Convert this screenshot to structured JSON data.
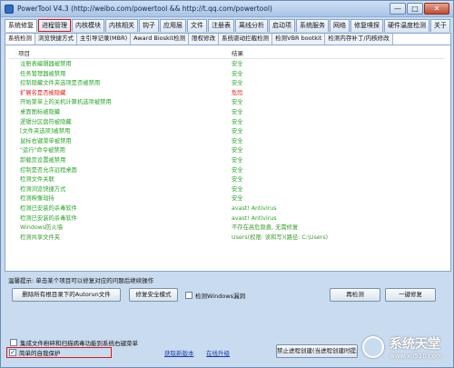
{
  "window": {
    "title": "PowerTool V4.3 (http://weibo.com/powertool && http://t.qq.com/powertool)",
    "minimize": "—",
    "maximize": "□",
    "close": "✕"
  },
  "main_tabs": [
    {
      "label": "系统修复",
      "active": true
    },
    {
      "label": "进程管理",
      "highlighted": true
    },
    {
      "label": "内核模块"
    },
    {
      "label": "内核相关"
    },
    {
      "label": "钩子"
    },
    {
      "label": "应用层"
    },
    {
      "label": "文件"
    },
    {
      "label": "注册表"
    },
    {
      "label": "离线分析"
    },
    {
      "label": "启动项"
    },
    {
      "label": "系统服务"
    },
    {
      "label": "网络"
    },
    {
      "label": "修复嗅探"
    },
    {
      "label": "硬件温度检测"
    },
    {
      "label": "关于"
    }
  ],
  "sub_tabs": [
    {
      "label": "系统检测",
      "active": true
    },
    {
      "label": "浏览快捷方式"
    },
    {
      "label": "主引导记录(MBR)"
    },
    {
      "label": "Award Bioskit检测"
    },
    {
      "label": "限权修改"
    },
    {
      "label": "系统驱动拦截检测"
    },
    {
      "label": "检测VBR bootkit"
    },
    {
      "label": "检测内存补丁/内核修改"
    }
  ],
  "list": {
    "header_item": "项目",
    "header_result": "结果",
    "rows": [
      {
        "item": "注册表编辑器被禁用",
        "result": "安全",
        "status": "safe"
      },
      {
        "item": "任务管理器被禁用",
        "result": "安全",
        "status": "safe"
      },
      {
        "item": "控制隐藏文件夹选项是否被禁用",
        "result": "安全",
        "status": "safe"
      },
      {
        "item": "扩展名是否被隐藏",
        "result": "危险",
        "status": "danger"
      },
      {
        "item": "开始菜单上的关机计算机选项被禁用",
        "result": "安全",
        "status": "safe"
      },
      {
        "item": "桌面图标被隐藏",
        "result": "安全",
        "status": "safe"
      },
      {
        "item": "逻辑分区盘符被隐藏",
        "result": "安全",
        "status": "safe"
      },
      {
        "item": "[文件夹选项]被禁用",
        "result": "安全",
        "status": "safe"
      },
      {
        "item": "鼠标右键菜单被禁用",
        "result": "安全",
        "status": "safe"
      },
      {
        "item": "\"运行\"命令被禁用",
        "result": "安全",
        "status": "safe"
      },
      {
        "item": "卸载页设置被禁用",
        "result": "安全",
        "status": "safe"
      },
      {
        "item": "控制是否允许远程桌面",
        "result": "安全",
        "status": "safe"
      },
      {
        "item": "检测文件关联",
        "result": "安全",
        "status": "safe"
      },
      {
        "item": "检测浏览快捷方式",
        "result": "安全",
        "status": "safe"
      },
      {
        "item": "检测映像劫持",
        "result": "安全",
        "status": "safe"
      },
      {
        "item": "检测已安装的杀毒软件",
        "result": "avast! Antivirus",
        "status": "safe"
      },
      {
        "item": "检测已安装的杀毒软件",
        "result": "avast! Antivirus",
        "status": "safe"
      },
      {
        "item": "Windows防火墙",
        "result": "不存在高危隐患, 无需修复",
        "status": "neutral"
      },
      {
        "item": "检测共享文件夹",
        "result": "Users(权限: 读和写)(路径: C:\\Users)",
        "status": "neutral"
      }
    ]
  },
  "tip": "温馨提示: 单击某个项目可以修复对应的问题后继续操作",
  "buttons": {
    "delete_autorun": "删除所有根目录下的Autorun文件",
    "repair_safe_mode": "修复安全模式",
    "check_windows_hidden": "检测Windows漏洞",
    "redetect": "再检测",
    "one_click_fix": "一键修复",
    "stop_process_monitor": "禁止进程创建(当进程创建时提示)"
  },
  "bottom": {
    "option_integrate": "集成文件粉碎和扫描病毒功能到系统右键菜单",
    "option_self_protect": "简单的自我保护",
    "link_new_version": "获取新版本",
    "link_online_upgrade": "在线升级"
  },
  "watermark": {
    "name": "系统天堂",
    "url": "www.xp510.com"
  },
  "colors": {
    "safe": "#2aa52a",
    "danger": "#e01a1a",
    "highlight_box": "#e0151b",
    "window_bg": "#c9dbef"
  }
}
